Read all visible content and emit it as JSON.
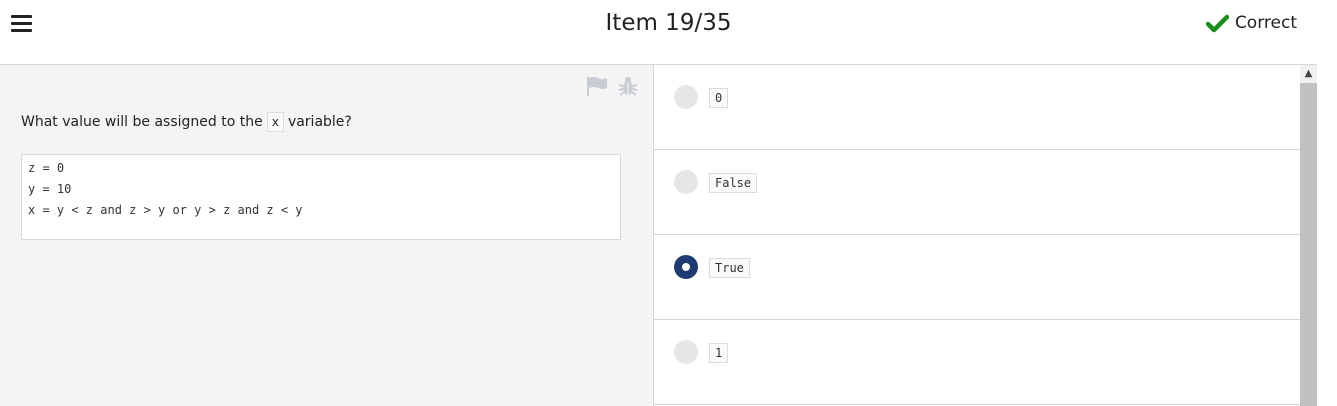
{
  "header": {
    "title": "Item 19/35",
    "status_label": "Correct",
    "status_color": "#1a8f1a",
    "menu_icon": "hamburger-menu-icon",
    "status_icon": "checkmark-icon"
  },
  "question": {
    "prefix": "What value will be assigned to the",
    "variable": "x",
    "suffix": "variable?",
    "tools": {
      "flag_icon": "flag-icon",
      "bug_icon": "bug-icon"
    },
    "code_lines": [
      "z = 0",
      "y = 10",
      "x = y < z and z > y or y > z and z < y"
    ]
  },
  "answers": [
    {
      "label": "0",
      "selected": false
    },
    {
      "label": "False",
      "selected": false
    },
    {
      "label": "True",
      "selected": true
    },
    {
      "label": "1",
      "selected": false
    }
  ],
  "colors": {
    "selected_radio": "#1e3c72",
    "unselected_radio": "#e6e6e6",
    "left_pane_bg": "#f4f4f4"
  }
}
